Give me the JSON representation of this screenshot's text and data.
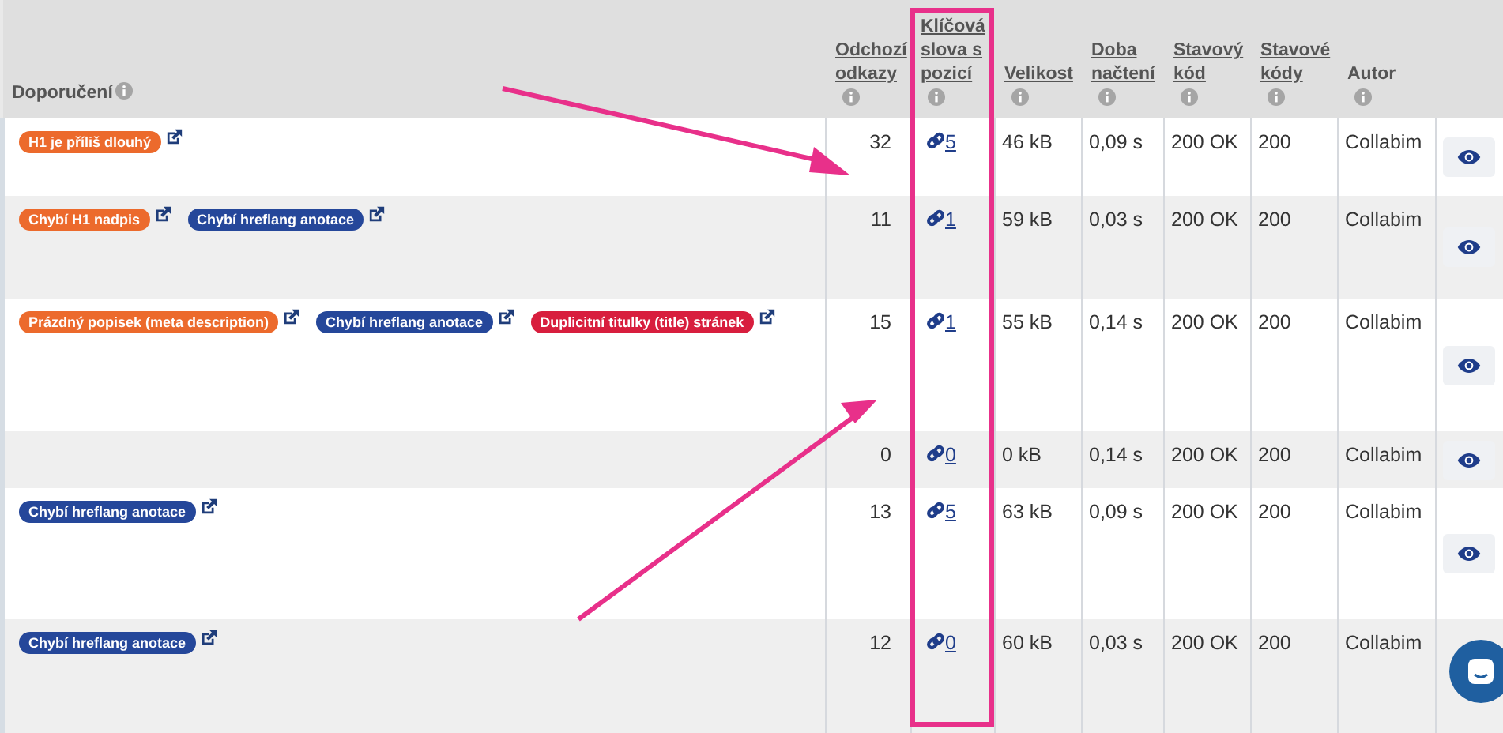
{
  "columns": [
    {
      "label": "Doporučení",
      "sortable": false,
      "highlighted": false
    },
    {
      "label": "Odchozí odkazy",
      "sortable": true,
      "highlighted": false
    },
    {
      "label": "Klíčová slova s pozicí",
      "sortable": true,
      "highlighted": true
    },
    {
      "label": "Velikost",
      "sortable": true,
      "highlighted": false
    },
    {
      "label": "Doba načtení",
      "sortable": true,
      "highlighted": false
    },
    {
      "label": "Stavový kód",
      "sortable": true,
      "highlighted": false
    },
    {
      "label": "Stavové kódy",
      "sortable": true,
      "highlighted": false
    },
    {
      "label": "Autor",
      "sortable": false,
      "highlighted": false
    }
  ],
  "rows": [
    {
      "tags": [
        {
          "label": "H1 je příliš dlouhý",
          "color": "#ec6a2c"
        }
      ],
      "outgoing": "32",
      "keywords": "5",
      "size": "46 kB",
      "load": "0,09 s",
      "status": "200 OK",
      "codes": "200",
      "author": "Collabim"
    },
    {
      "tags": [
        {
          "label": "Chybí H1 nadpis",
          "color": "#ec6a2c"
        },
        {
          "label": "Chybí hreflang anotace",
          "color": "#25479a"
        }
      ],
      "outgoing": "11",
      "keywords": "1",
      "size": "59 kB",
      "load": "0,03 s",
      "status": "200 OK",
      "codes": "200",
      "author": "Collabim"
    },
    {
      "tags": [
        {
          "label": "Prázdný popisek (meta description)",
          "color": "#ec6a2c"
        },
        {
          "label": "Chybí hreflang anotace",
          "color": "#25479a"
        },
        {
          "label": "Duplicitní titulky (title) stránek",
          "color": "#d81e3e"
        }
      ],
      "outgoing": "15",
      "keywords": "1",
      "size": "55 kB",
      "load": "0,14 s",
      "status": "200 OK",
      "codes": "200",
      "author": "Collabim"
    },
    {
      "tags": [],
      "outgoing": "0",
      "keywords": "0",
      "size": "0 kB",
      "load": "0,14 s",
      "status": "200 OK",
      "codes": "200",
      "author": "Collabim"
    },
    {
      "tags": [
        {
          "label": "Chybí hreflang anotace",
          "color": "#25479a"
        }
      ],
      "outgoing": "13",
      "keywords": "5",
      "size": "63 kB",
      "load": "0,09 s",
      "status": "200 OK",
      "codes": "200",
      "author": "Collabim"
    },
    {
      "tags": [
        {
          "label": "Chybí hreflang anotace",
          "color": "#25479a"
        }
      ],
      "outgoing": "12",
      "keywords": "0",
      "size": "60 kB",
      "load": "0,03 s",
      "status": "200 OK",
      "codes": "200",
      "author": "Collabim"
    }
  ]
}
